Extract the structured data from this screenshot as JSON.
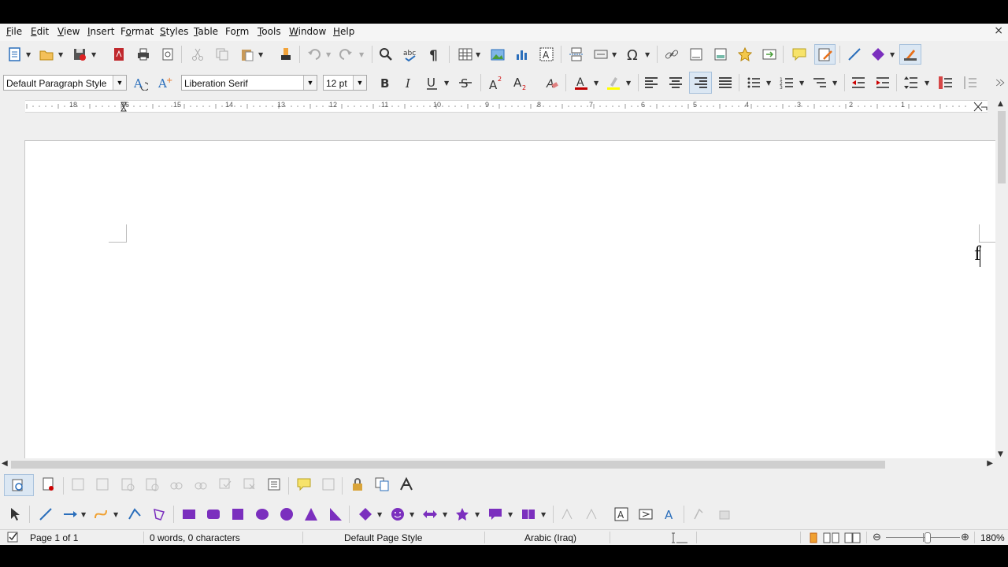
{
  "menu": {
    "items": [
      {
        "key": "file",
        "pre": "",
        "u": "F",
        "post": "ile"
      },
      {
        "key": "edit",
        "pre": "",
        "u": "E",
        "post": "dit"
      },
      {
        "key": "view",
        "pre": "",
        "u": "V",
        "post": "iew"
      },
      {
        "key": "insert",
        "pre": "",
        "u": "I",
        "post": "nsert"
      },
      {
        "key": "format",
        "pre": "F",
        "u": "o",
        "post": "rmat"
      },
      {
        "key": "styles",
        "pre": "",
        "u": "S",
        "post": "tyles"
      },
      {
        "key": "table",
        "pre": "",
        "u": "T",
        "post": "able"
      },
      {
        "key": "form",
        "pre": "Fo",
        "u": "r",
        "post": "m"
      },
      {
        "key": "tools",
        "pre": "",
        "u": "T",
        "post": "ools"
      },
      {
        "key": "window",
        "pre": "",
        "u": "W",
        "post": "indow"
      },
      {
        "key": "help",
        "pre": "",
        "u": "H",
        "post": "elp"
      }
    ],
    "close_glyph": "×"
  },
  "formatting": {
    "paragraph_style": "Default Paragraph Style",
    "font_name": "Liberation Serif",
    "font_size": "12 pt"
  },
  "ruler": {
    "labels": [
      "18",
      "16",
      "15",
      "14",
      "13",
      "12",
      "11",
      "10",
      "9",
      "8",
      "7",
      "6",
      "5",
      "4",
      "3",
      "2",
      "1"
    ]
  },
  "document": {
    "cursor_char": "f"
  },
  "status": {
    "page": "Page 1 of 1",
    "words": "0 words, 0 characters",
    "page_style": "Default Page Style",
    "language": "Arabic (Iraq)",
    "zoom": "180%"
  },
  "colors": {
    "font_color": "#c00000",
    "highlight_color": "#ffff00",
    "accent_orange": "#e8701a",
    "accent_blue": "#2a6ebb",
    "accent_purple": "#7b2fbe"
  }
}
